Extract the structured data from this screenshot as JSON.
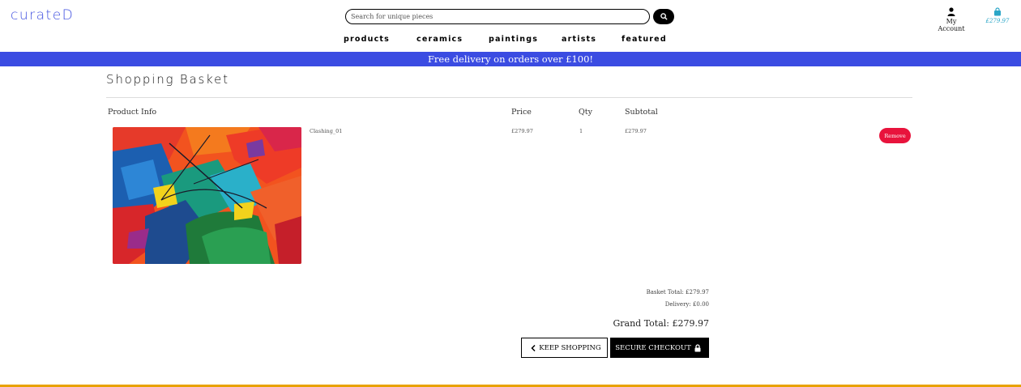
{
  "header": {
    "logo": "curateD",
    "search_placeholder": "Search for unique pieces",
    "account_label": "My Account",
    "basket_total": "£279.97",
    "icons": {
      "search": "search-icon",
      "account": "user-icon",
      "basket": "shopping-bag-icon"
    }
  },
  "nav": {
    "items": [
      {
        "label": "products"
      },
      {
        "label": "ceramics"
      },
      {
        "label": "paintings"
      },
      {
        "label": "artists"
      },
      {
        "label": "featured"
      }
    ]
  },
  "banner": {
    "text": "Free delivery on orders over £100!"
  },
  "page": {
    "title": "Shopping Basket"
  },
  "table": {
    "headers": [
      "Product Info",
      "Price",
      "Qty",
      "Subtotal"
    ],
    "rows": [
      {
        "name": "Clashing_01",
        "price": "£279.97",
        "qty": "1",
        "subtotal": "£279.97",
        "remove_label": "Remove"
      }
    ]
  },
  "summary": {
    "basket_total": "Basket Total: £279.97",
    "delivery": "Delivery: £0.00",
    "grand_total": "Grand Total: £279.97"
  },
  "actions": {
    "keep_shopping": "KEEP SHOPPING",
    "secure_checkout": "SECURE CHECKOUT"
  },
  "colors": {
    "brand": "#3f4fe0",
    "banner": "#3b4ce2",
    "remove": "#e8133c",
    "basket_accent": "#2aa6c7",
    "footer_accent": "#e8a200"
  }
}
